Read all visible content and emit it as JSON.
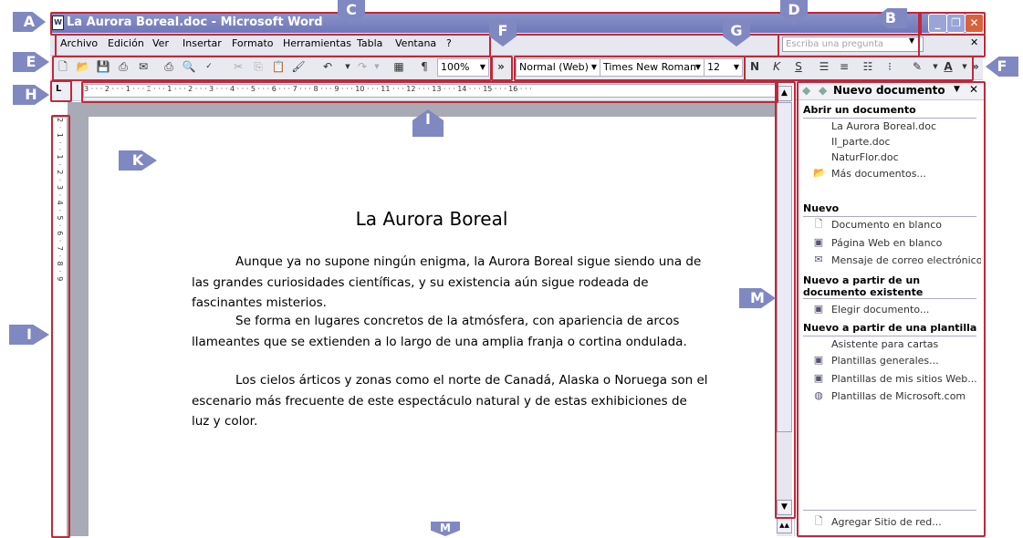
{
  "window": {
    "title": "La Aurora Boreal.doc - Microsoft Word",
    "icon": "word-doc-icon",
    "controls": {
      "minimize": "_",
      "restore": "❐",
      "close": "✕"
    }
  },
  "menu": {
    "items": [
      "Archivo",
      "Edición",
      "Ver",
      "Insertar",
      "Formato",
      "Herramientas",
      "Tabla",
      "Ventana",
      "?"
    ],
    "ask_placeholder": "Escriba una pregunta",
    "close_doc": "✕"
  },
  "toolbar": {
    "zoom": "100%",
    "style": "Normal (Web)",
    "font": "Times New Roman",
    "size": "12",
    "bold": "N",
    "italic": "K",
    "underline": "S",
    "more": "»"
  },
  "ruler": {
    "corner": "L",
    "horizontal": "3 · · · 2 · · · 1 · · · ⌶ · · · 1 · · · 2 · · · 3 · · · 4 · · · 5 · · · 6 · · · 7 · · · 8 · · · 9 · · · 10 · · · 11 · · · 12 · · · 13 · · · 14 · · · 15 · · · 16 · · ·",
    "vertical": "2 · 1 · · 1 · 2 · 3 · 4 · 5 · 6 · 7 · 8 · 9"
  },
  "document": {
    "title": "La Aurora Boreal",
    "paragraphs": [
      "Aunque ya no supone ningún enigma, la Aurora Boreal sigue siendo una de las grandes curiosidades científicas, y su existencia aún sigue rodeada de fascinantes misterios.",
      "Se forma en lugares concretos de la atmósfera, con apariencia de arcos llameantes que se extienden a lo largo de una amplia franja o cortina ondulada.",
      "Los cielos árticos y zonas como el norte de Canadá, Alaska o Noruega son el escenario más frecuente de este espectáculo natural y de estas exhibiciones de luz y color."
    ]
  },
  "taskpane": {
    "title": "Nuevo documento",
    "sections": [
      {
        "heading": "Abrir un documento",
        "items": [
          "La Aurora Boreal.doc",
          "II_parte.doc",
          "NaturFlor.doc",
          "Más documentos..."
        ]
      },
      {
        "heading": "Nuevo",
        "items": [
          "Documento en blanco",
          "Página Web en blanco",
          "Mensaje de correo electrónico en blanco"
        ]
      },
      {
        "heading": "Nuevo a partir de un documento existente",
        "items": [
          "Elegir documento..."
        ]
      },
      {
        "heading": "Nuevo a partir de una plantilla",
        "items": [
          "Asistente para cartas",
          "Plantillas generales...",
          "Plantillas de mis sitios Web...",
          "Plantillas de Microsoft.com"
        ]
      }
    ],
    "footer_item": "Agregar Sitio de red..."
  },
  "callouts": [
    "A",
    "B",
    "C",
    "D",
    "E",
    "F",
    "F",
    "G",
    "H",
    "I",
    "I",
    "K",
    "M",
    "M"
  ],
  "colors": {
    "callout": "#8088c2",
    "highlight_box": "#c0283a",
    "titlebar": "#7a83c0"
  }
}
